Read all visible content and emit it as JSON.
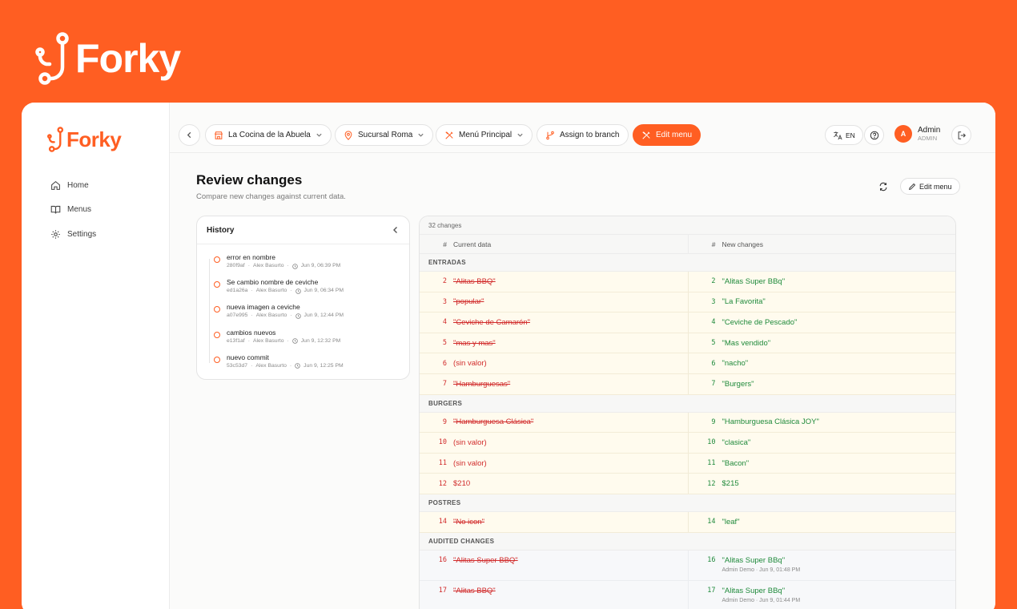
{
  "brand": {
    "name": "Forky",
    "color": "#FF5E22"
  },
  "sidebar": {
    "items": [
      {
        "label": "Home",
        "icon": "home-icon"
      },
      {
        "label": "Menus",
        "icon": "book-icon"
      },
      {
        "label": "Settings",
        "icon": "gear-icon"
      }
    ]
  },
  "topbar": {
    "restaurant": "La Cocina de la Abuela",
    "branch": "Sucursal Roma",
    "menu": "Menú Principal",
    "assign_label": "Assign to branch",
    "edit_label": "Edit menu",
    "language": "EN",
    "user_name": "Admin",
    "user_role": "ADMIN",
    "user_initial": "A"
  },
  "page": {
    "title": "Review changes",
    "subtitle": "Compare new changes against current data.",
    "edit_button": "Edit menu"
  },
  "history": {
    "title": "History",
    "commits": [
      {
        "message": "error en nombre",
        "hash": "280f9af",
        "author": "Alex Basurto",
        "time": "Jun 9, 06:39 PM"
      },
      {
        "message": "Se cambio nombre de ceviche",
        "hash": "ed1a26a",
        "author": "Alex Basurto",
        "time": "Jun 9, 06:34 PM"
      },
      {
        "message": "nueva imagen a ceviche",
        "hash": "a07e995",
        "author": "Alex Basurto",
        "time": "Jun 9, 12:44 PM"
      },
      {
        "message": "cambios nuevos",
        "hash": "e13f1af",
        "author": "Alex Basurto",
        "time": "Jun 9, 12:32 PM"
      },
      {
        "message": "nuevo commit",
        "hash": "53c53d7",
        "author": "Alex Basurto",
        "time": "Jun 9, 12:25 PM"
      }
    ]
  },
  "diff": {
    "count_label": "32 changes",
    "col_current": "Current data",
    "col_new": "New changes",
    "hash_label": "#",
    "sections": [
      {
        "name": "ENTRADAS",
        "rows": [
          {
            "num": "2",
            "old": "\"Alitas BBQ\"",
            "new": "\"Alitas Super BBq\""
          },
          {
            "num": "3",
            "old": "\"popular\"",
            "new": "\"La Favorita\""
          },
          {
            "num": "4",
            "old": "\"Ceviche de Camarón\"",
            "new": "\"Ceviche de Pescado\""
          },
          {
            "num": "5",
            "old": "\"mas y mas\"",
            "new": "\"Mas vendido\""
          },
          {
            "num": "6",
            "old": "(sin valor)",
            "new": "\"nacho\""
          },
          {
            "num": "7",
            "old": "\"Hamburguesas\"",
            "new": "\"Burgers\""
          }
        ]
      },
      {
        "name": "BURGERS",
        "rows": [
          {
            "num": "9",
            "old": "\"Hamburguesa Clásica\"",
            "new": "\"Hamburguesa Clásica JOY\""
          },
          {
            "num": "10",
            "old": "(sin valor)",
            "new": "\"clasica\""
          },
          {
            "num": "11",
            "old": "(sin valor)",
            "new": "\"Bacon\""
          },
          {
            "num": "12",
            "old": "$210",
            "new": "$215"
          }
        ]
      },
      {
        "name": "POSTRES",
        "rows": [
          {
            "num": "14",
            "old": "\"No icon\"",
            "new": "\"leaf\""
          }
        ]
      }
    ],
    "audited": {
      "name": "AUDITED CHANGES",
      "rows": [
        {
          "num": "16",
          "old": "\"Alitas Super BBQ\"",
          "new": "\"Alitas Super BBq\"",
          "meta": "Admin Demo · Jun 9, 01:48 PM"
        },
        {
          "num": "17",
          "old": "\"Alitas BBQ\"",
          "new": "\"Alitas Super BBq\"",
          "meta": "Admin Demo · Jun 9, 01:44 PM"
        }
      ]
    }
  }
}
